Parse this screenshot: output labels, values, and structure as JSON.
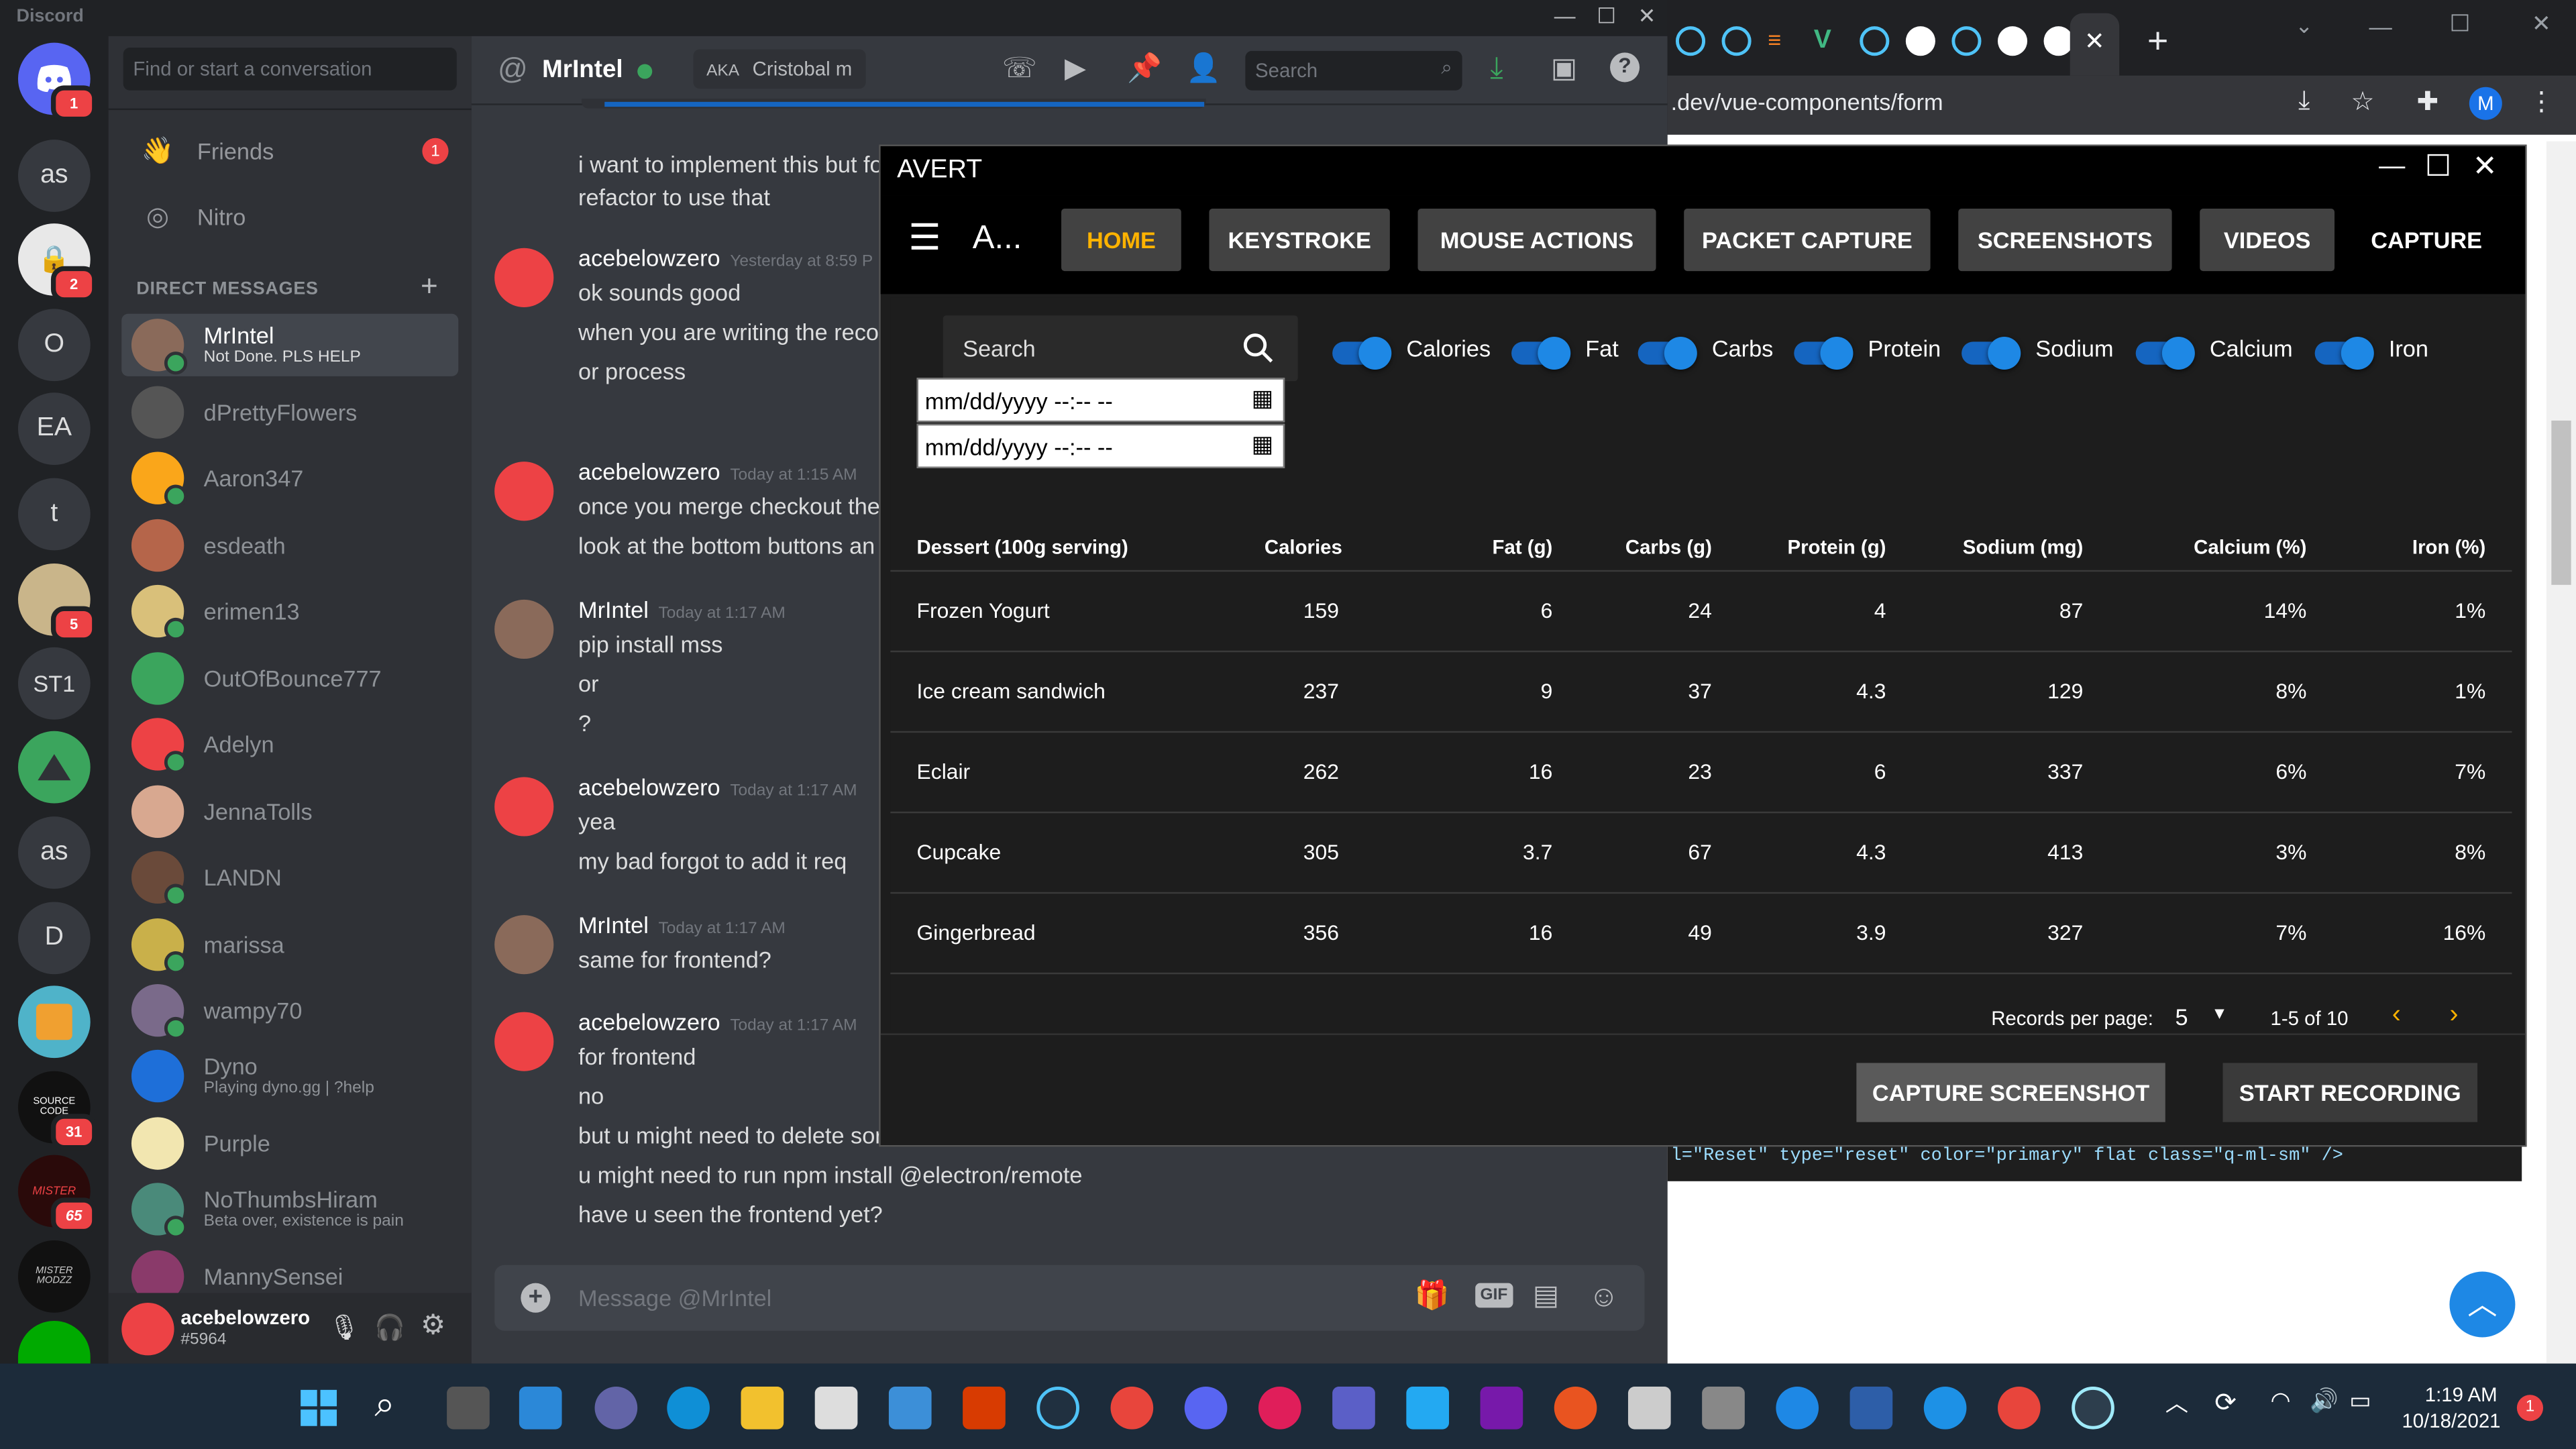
{
  "discord": {
    "app_title": "Discord",
    "search_placeholder": "Find or start a conversation",
    "nav": {
      "friends": "Friends",
      "friends_badge": "1",
      "nitro": "Nitro"
    },
    "dm_header": "DIRECT MESSAGES",
    "guilds": [
      {
        "label": "",
        "badge": "1"
      },
      {
        "label": "as",
        "badge": ""
      },
      {
        "label": "",
        "badge": "2"
      },
      {
        "label": "O",
        "badge": ""
      },
      {
        "label": "EA",
        "badge": ""
      },
      {
        "label": "t",
        "badge": ""
      },
      {
        "label": "",
        "badge": "5"
      },
      {
        "label": "ST1",
        "badge": ""
      },
      {
        "label": "",
        "badge": ""
      },
      {
        "label": "as",
        "badge": ""
      },
      {
        "label": "D",
        "badge": ""
      },
      {
        "label": "",
        "badge": ""
      },
      {
        "label": "SOURCE CODE",
        "badge": "31"
      },
      {
        "label": "MISTER",
        "badge": "65"
      },
      {
        "label": "MISTER MODZZ",
        "badge": ""
      },
      {
        "label": "",
        "badge": ""
      }
    ],
    "dms": [
      {
        "name": "MrIntel",
        "sub": "Not Done. PLS HELP"
      },
      {
        "name": "dPrettyFlowers",
        "sub": ""
      },
      {
        "name": "Aaron347",
        "sub": ""
      },
      {
        "name": "esdeath",
        "sub": ""
      },
      {
        "name": "erimen13",
        "sub": ""
      },
      {
        "name": "OutOfBounce777",
        "sub": ""
      },
      {
        "name": "Adelyn",
        "sub": ""
      },
      {
        "name": "JennaTolls",
        "sub": ""
      },
      {
        "name": "LANDN",
        "sub": ""
      },
      {
        "name": "marissa",
        "sub": ""
      },
      {
        "name": "wampy70",
        "sub": ""
      },
      {
        "name": "Dyno",
        "sub": "Playing dyno.gg | ?help"
      },
      {
        "name": "Purple",
        "sub": ""
      },
      {
        "name": "NoThumbsHiram",
        "sub": "Beta over, existence is pain"
      },
      {
        "name": "MannySensei",
        "sub": ""
      }
    ],
    "user": {
      "name": "acebelowzero",
      "tag": "#5964"
    },
    "chat": {
      "channel": "MrIntel",
      "aka_label": "AKA",
      "aka": "Cristobal m",
      "search": "Search",
      "input_placeholder": "Message @MrIntel",
      "gif": "GIF",
      "messages": [
        {
          "author": "",
          "time": "",
          "lines": [
            "i want to implement this but fo",
            "refactor to use that"
          ]
        },
        {
          "author": "acebelowzero",
          "time": "Yesterday at 8:59 P",
          "lines": [
            "ok sounds good",
            "when you are writing the reco",
            "or process"
          ]
        },
        {
          "author": "acebelowzero",
          "time": "Today at 1:15 AM",
          "lines": [
            "once you merge checkout the",
            "look at the bottom buttons an"
          ]
        },
        {
          "author": "MrIntel",
          "time": "Today at 1:17 AM",
          "lines": [
            "pip install mss",
            "or",
            "?"
          ]
        },
        {
          "author": "acebelowzero",
          "time": "Today at 1:17 AM",
          "lines": [
            "yea",
            "my bad forgot to add it req"
          ]
        },
        {
          "author": "MrIntel",
          "time": "Today at 1:17 AM",
          "lines": [
            "same for frontend?"
          ]
        },
        {
          "author": "acebelowzero",
          "time": "Today at 1:17 AM",
          "lines": [
            "for frontend",
            "no",
            "but u might need to delete sor",
            "u might need to run npm install @electron/remote",
            "have u seen the frontend yet?"
          ]
        }
      ]
    }
  },
  "chrome": {
    "url": ".dev/vue-components/form",
    "profile": "M",
    "code_line": "l=\"Reset\" type=\"reset\" color=\"primary\" flat class=\"q-ml-sm\" />"
  },
  "avert": {
    "title": "AVERT",
    "brand": "A...",
    "nav": [
      "HOME",
      "KEYSTROKE",
      "MOUSE ACTIONS",
      "PACKET CAPTURE",
      "SCREENSHOTS",
      "VIDEOS",
      "CAPTURE"
    ],
    "search_placeholder": "Search",
    "toggles": [
      "Calories",
      "Fat",
      "Carbs",
      "Protein",
      "Sodium",
      "Calcium",
      "Iron"
    ],
    "date_placeholder": "mm/dd/yyyy --:-- --",
    "columns": [
      "Dessert (100g serving)",
      "Calories",
      "Fat (g)",
      "Carbs (g)",
      "Protein (g)",
      "Sodium (mg)",
      "Calcium (%)",
      "Iron (%)"
    ],
    "rows": [
      [
        "Frozen Yogurt",
        "159",
        "6",
        "24",
        "4",
        "87",
        "14%",
        "1%"
      ],
      [
        "Ice cream sandwich",
        "237",
        "9",
        "37",
        "4.3",
        "129",
        "8%",
        "1%"
      ],
      [
        "Eclair",
        "262",
        "16",
        "23",
        "6",
        "337",
        "6%",
        "7%"
      ],
      [
        "Cupcake",
        "305",
        "3.7",
        "67",
        "4.3",
        "413",
        "3%",
        "8%"
      ],
      [
        "Gingerbread",
        "356",
        "16",
        "49",
        "3.9",
        "327",
        "7%",
        "16%"
      ]
    ],
    "records_label": "Records per page:",
    "records_value": "5",
    "range": "1-5 of 10",
    "btn_screenshot": "CAPTURE SCREENSHOT",
    "btn_record": "START RECORDING"
  },
  "taskbar": {
    "time": "1:19 AM",
    "date": "10/18/2021",
    "notif": "1"
  },
  "colors": {
    "accent": "#ffb300",
    "discord_blurple": "#5865f2",
    "toggle": "#1e88e5"
  }
}
